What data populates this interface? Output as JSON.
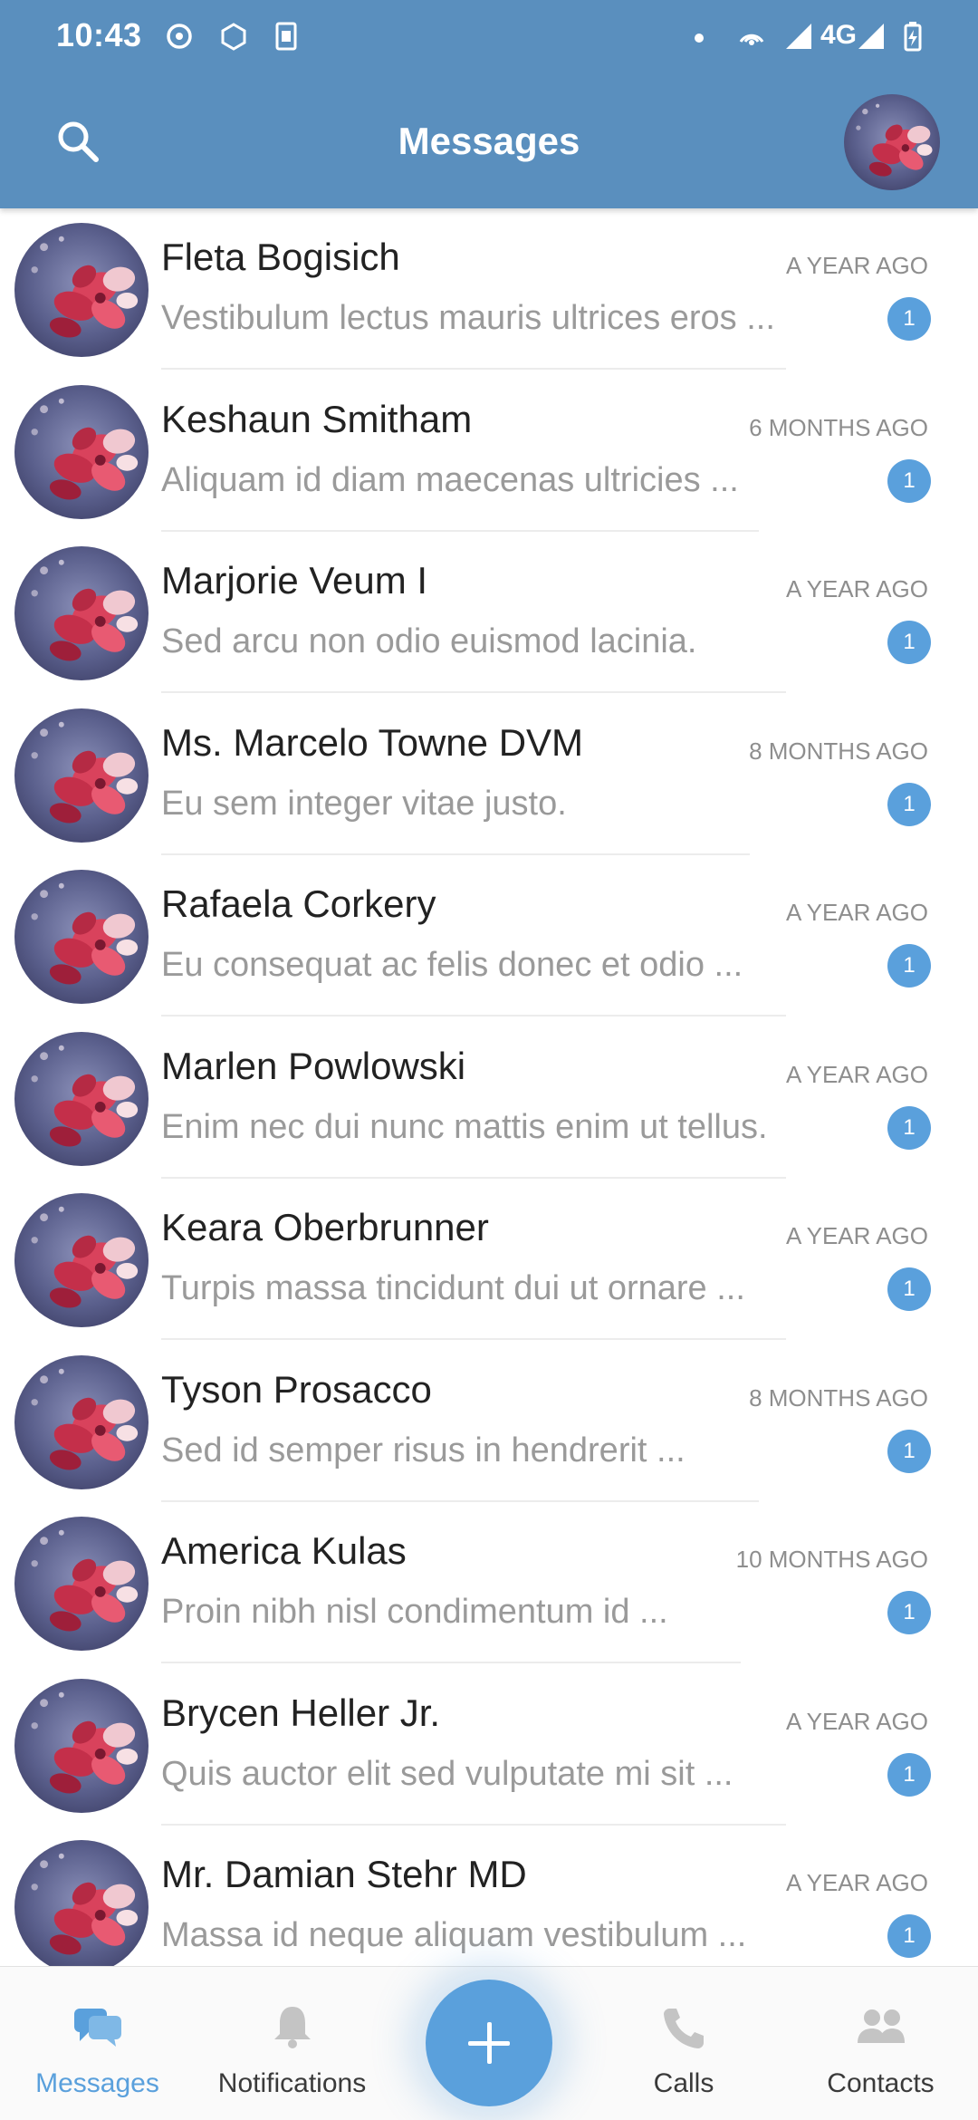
{
  "status_bar": {
    "time": "10:43",
    "network": "4G"
  },
  "header": {
    "title": "Messages",
    "background": "#5a8fbe"
  },
  "conversations": [
    {
      "name": "Fleta Bogisich",
      "preview": "Vestibulum lectus mauris ultrices eros ...",
      "time": "A YEAR AGO",
      "unread": "1"
    },
    {
      "name": "Keshaun Smitham",
      "preview": "Aliquam id diam maecenas ultricies ...",
      "time": "6 MONTHS AGO",
      "unread": "1"
    },
    {
      "name": "Marjorie Veum I",
      "preview": "Sed arcu non odio euismod lacinia.",
      "time": "A YEAR AGO",
      "unread": "1"
    },
    {
      "name": "Ms. Marcelo Towne DVM",
      "preview": "Eu sem integer vitae justo.",
      "time": "8 MONTHS AGO",
      "unread": "1"
    },
    {
      "name": "Rafaela Corkery",
      "preview": "Eu consequat ac felis donec et odio ...",
      "time": "A YEAR AGO",
      "unread": "1"
    },
    {
      "name": "Marlen Powlowski",
      "preview": "Enim nec dui nunc mattis enim ut tellus.",
      "time": "A YEAR AGO",
      "unread": "1"
    },
    {
      "name": "Keara Oberbrunner",
      "preview": "Turpis massa tincidunt dui ut ornare ...",
      "time": "A YEAR AGO",
      "unread": "1"
    },
    {
      "name": "Tyson Prosacco",
      "preview": "Sed id semper risus in hendrerit ...",
      "time": "8 MONTHS AGO",
      "unread": "1"
    },
    {
      "name": "America Kulas",
      "preview": "Proin nibh nisl condimentum id ...",
      "time": "10 MONTHS AGO",
      "unread": "1"
    },
    {
      "name": "Brycen Heller Jr.",
      "preview": "Quis auctor elit sed vulputate mi sit ...",
      "time": "A YEAR AGO",
      "unread": "1"
    },
    {
      "name": "Mr. Damian Stehr MD",
      "preview": "Massa id neque aliquam vestibulum ...",
      "time": "A YEAR AGO",
      "unread": "1"
    }
  ],
  "bottom_nav": {
    "items": [
      {
        "label": "Messages",
        "icon": "chat-bubbles-icon",
        "active": true
      },
      {
        "label": "Notifications",
        "icon": "bell-icon",
        "active": false
      },
      {
        "label": "Calls",
        "icon": "phone-icon",
        "active": false
      },
      {
        "label": "Contacts",
        "icon": "people-icon",
        "active": false
      }
    ],
    "fab_icon": "plus-icon",
    "accent": "#5aa0dc"
  }
}
